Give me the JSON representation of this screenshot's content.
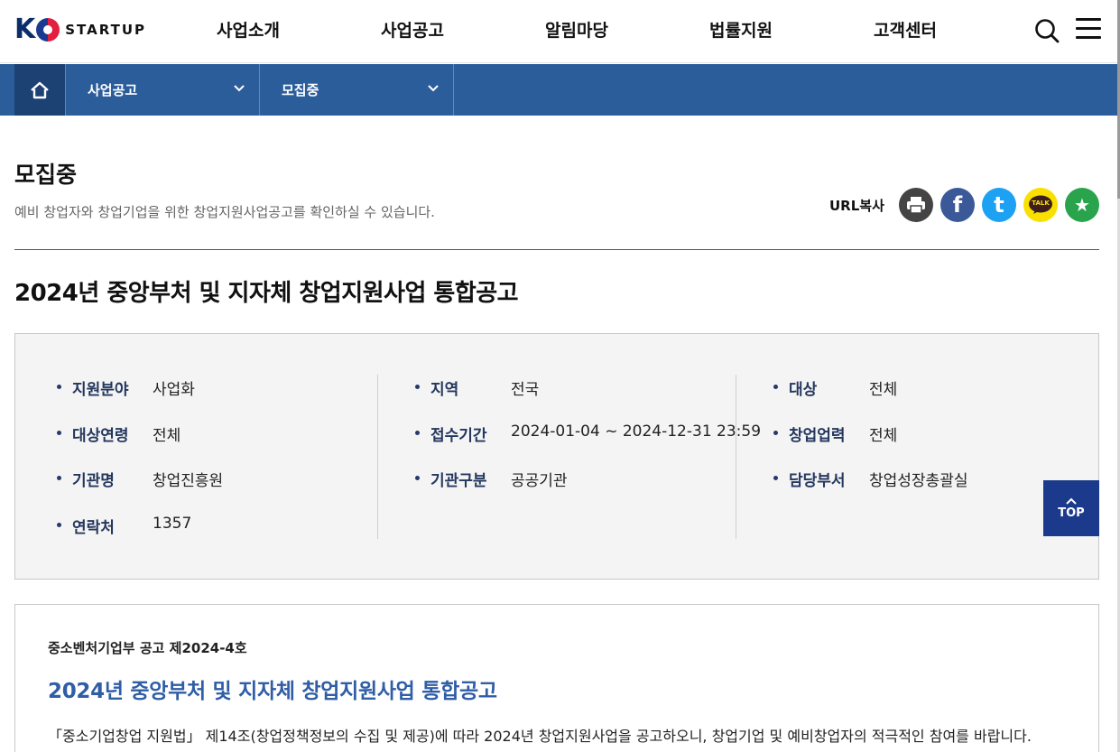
{
  "header": {
    "logo_letter": "K",
    "logo_word": "STARTUP",
    "nav": [
      "사업소개",
      "사업공고",
      "알림마당",
      "법률지원",
      "고객센터"
    ]
  },
  "location": {
    "level1": "사업공고",
    "level2": "모집중"
  },
  "page": {
    "title": "모집중",
    "description": "예비 창업자와 창업기업을 위한 창업지원사업공고를 확인하실 수 있습니다.",
    "url_copy": "URL복사",
    "kakao_label": "TALK"
  },
  "notice": {
    "title": "2024년 중앙부처 및 지자체 창업지원사업 통합공고",
    "info": {
      "col1": [
        {
          "label": "지원분야",
          "value": "사업화"
        },
        {
          "label": "대상연령",
          "value": "전체"
        },
        {
          "label": "기관명",
          "value": "창업진흥원"
        },
        {
          "label": "연락처",
          "value": "1357"
        }
      ],
      "col2": [
        {
          "label": "지역",
          "value": "전국"
        },
        {
          "label": "접수기간",
          "value": "2024-01-04 ~ 2024-12-31 23:59"
        },
        {
          "label": "기관구분",
          "value": "공공기관"
        }
      ],
      "col3": [
        {
          "label": "대상",
          "value": "전체"
        },
        {
          "label": "창업업력",
          "value": "전체"
        },
        {
          "label": "담당부서",
          "value": "창업성장총괄실"
        }
      ]
    }
  },
  "content": {
    "doc_no": "중소벤처기업부 공고 제2024-4호",
    "doc_title": "2024년 중앙부처 및 지자체 창업지원사업 통합공고",
    "doc_text": "「중소기업창업 지원법」 제14조(창업정책정보의 수집 및 제공)에 따라 2024년 창업지원사업을 공고하오니, 창업기업 및 예비창업자의 적극적인 참여를 바랍니다."
  },
  "top_button": "TOP",
  "colors": {
    "nav_bar": "#2c5d9b",
    "home_bg": "#1c4173",
    "label": "#24375e",
    "doc_title": "#2f5da6",
    "top_button": "#1b3a8c"
  }
}
